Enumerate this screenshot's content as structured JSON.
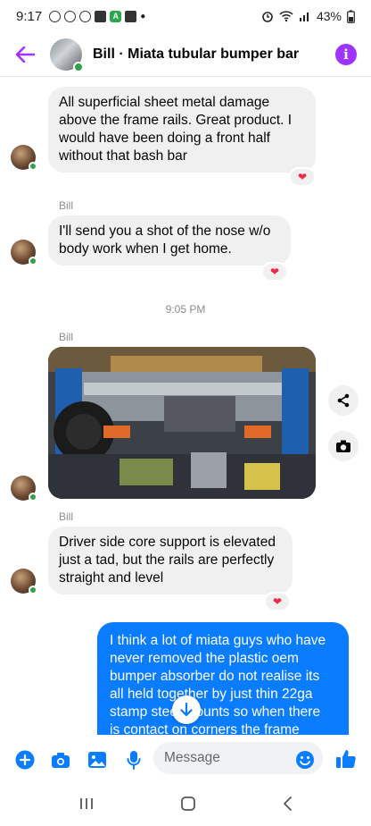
{
  "status": {
    "time": "9:17",
    "left_icons": [
      "messenger-icon",
      "sync-icon",
      "messenger-icon",
      "youtube-icon",
      "a-app-icon",
      "bag-icon",
      "dot-icon"
    ],
    "right_icons": [
      "alarm-icon",
      "wifi-icon",
      "signal-icon"
    ],
    "battery": "43%"
  },
  "header": {
    "title": "Bill · Miata tubular bumper bar",
    "online": true
  },
  "messages": [
    {
      "sender": "",
      "text_lines": [
        "All superficial sheet metal damage",
        "above the frame rails. Great product. I",
        "would have been doing a front half",
        "without that bash bar"
      ],
      "reaction": "❤"
    },
    {
      "sender": "Bill",
      "text_lines": [
        "I'll send you a shot of the nose w/o",
        "body work when I get home."
      ],
      "reaction": "❤"
    },
    {
      "sender": "Bill",
      "text_lines": [
        "Driver side core support is elevated",
        "just a tad, but the rails are perfectly",
        "straight and level"
      ],
      "reaction": "❤"
    }
  ],
  "timestamp": "9:05 PM",
  "photo_sender": "Bill",
  "outgoing": {
    "text_lines": [
      "I think a lot of miata guys who have",
      "never removed the plastic oem",
      "bumper absorber do not realise its",
      "all held together by just thin 22ga",
      "stamp steel mounts so when there",
      "is contact on corners the frame"
    ]
  },
  "composer": {
    "placeholder": "Message"
  },
  "colors": {
    "accent": "#0a7cff",
    "header_accent": "#a033ff",
    "heart": "#f02849",
    "online": "#31a24c"
  }
}
